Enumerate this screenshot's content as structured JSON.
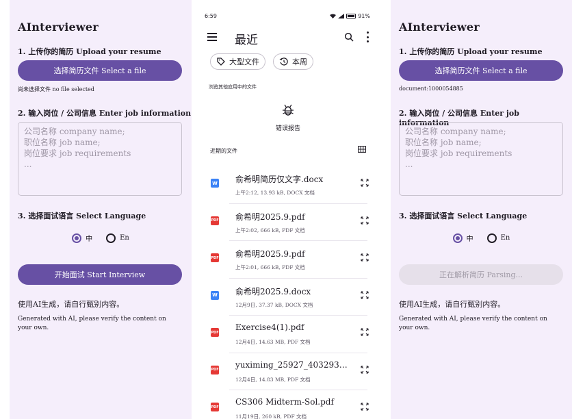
{
  "left": {
    "app_title": "AInterviewer",
    "upload_label": "1. 上传你的简历 Upload your resume",
    "select_file_label": "选择简历文件 Select a file",
    "file_status": "尚未选择文件 no file selected",
    "job_label": "2. 输入岗位 / 公司信息 Enter job information",
    "job_placeholder": "公司名称 company name;\n职位名称 job name;\n岗位要求 job requirements\n...",
    "language_label": "3. 选择面试语言 Select Language",
    "lang_cn": "中",
    "lang_en": "En",
    "selected_language": "中",
    "start_label": "开始面试 Start Interview",
    "disclaimer_cn": "使用AI生成，请自行甄别内容。",
    "disclaimer_en": "Generated with AI, please verify the content on your own."
  },
  "picker": {
    "time": "6:59",
    "battery": "91%",
    "title": "最近",
    "chip_large": "大型文件",
    "chip_week": "本周",
    "browse_label": "浏览其他应用中的文件",
    "bug_report_label": "错误报告",
    "recent_files_label": "近期的文件",
    "files": [
      {
        "type": "W",
        "name": "俞希明简历仅文字.docx",
        "meta": "上午2:12, 13.93 kB, DOCX 文档"
      },
      {
        "type": "PDF",
        "name": "俞希明2025.9.pdf",
        "meta": "上午2:02, 666 kB, PDF 文档"
      },
      {
        "type": "PDF",
        "name": "俞希明2025.9.pdf",
        "meta": "上午2:01, 666 kB, PDF 文档"
      },
      {
        "type": "W",
        "name": "俞希明2025.9.docx",
        "meta": "12月9日, 37.37 kB, DOCX 文档"
      },
      {
        "type": "PDF",
        "name": "Exercise4(1).pdf",
        "meta": "12月4日, 14.63 MB, PDF 文档"
      },
      {
        "type": "PDF",
        "name": "yuximing_25927_4032932_…",
        "meta": "12月4日, 14.83 MB, PDF 文档"
      },
      {
        "type": "PDF",
        "name": "CS306 Midterm-Sol.pdf",
        "meta": "11月19日, 260 kB, PDF 文档"
      }
    ],
    "icons": [
      "menu-icon",
      "search-icon",
      "more-vert-icon",
      "tag-icon",
      "history-icon",
      "bug-icon",
      "grid-view-icon",
      "expand-icon"
    ]
  },
  "right": {
    "app_title": "AInterviewer",
    "upload_label": "1. 上传你的简历 Upload your resume",
    "select_file_label": "选择简历文件 Select a file",
    "file_status": "document:1000054885",
    "job_label": "2. 输入岗位 / 公司信息 Enter job information",
    "job_placeholder": "公司名称 company name;\n职位名称 job name;\n岗位要求 job requirements\n...",
    "language_label": "3. 选择面试语言 Select Language",
    "lang_cn": "中",
    "lang_en": "En",
    "selected_language": "中",
    "parsing_label": "正在解析简历 Parsing...",
    "disclaimer_cn": "使用AI生成，请自行甄别内容。",
    "disclaimer_en": "Generated with AI, please verify the content on your own."
  },
  "colors": {
    "primary": "#6750a4",
    "screen_bg": "#f5eefb",
    "disabled_bg": "#e6e0ea",
    "word_icon": "#3b82f6",
    "pdf_icon": "#e53935"
  }
}
